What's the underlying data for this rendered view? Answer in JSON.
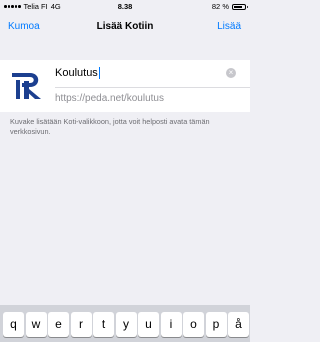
{
  "status_bar": {
    "carrier": "Telia FI",
    "network": "4G",
    "time": "8.38",
    "battery_percent": "82 %",
    "battery_level": 0.82
  },
  "nav": {
    "left_label": "Kumoa",
    "title": "Lisää Kotiin",
    "right_label": "Lisää",
    "accent_color": "#007aff"
  },
  "bookmark": {
    "logo_icon": "peda-net-logo",
    "title_value": "Koulutus",
    "url_value": "https://peda.net/koulutus",
    "clear_icon": "clear-circle-icon"
  },
  "help_text": "Kuvake lisätään Koti-valikkoon, jotta voit helposti avata tämän verkkosivun.",
  "keyboard": {
    "keys": [
      "q",
      "w",
      "e",
      "r",
      "t",
      "y",
      "u",
      "i",
      "o",
      "p",
      "å"
    ]
  }
}
